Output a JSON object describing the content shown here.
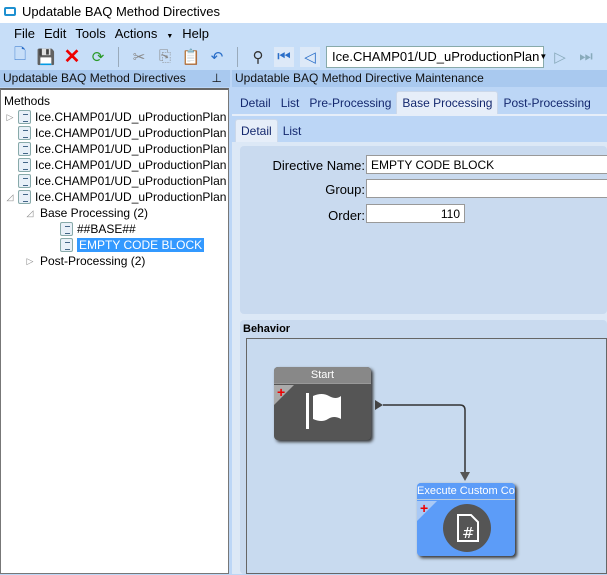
{
  "window": {
    "title": "Updatable BAQ Method Directives"
  },
  "menu": [
    "File",
    "Edit",
    "Tools",
    "Actions",
    "Help"
  ],
  "toolbar": {
    "navigator_value": "Ice.CHAMP01/UD_uProductionPlan"
  },
  "left_panel": {
    "header": "Updatable BAQ Method Directives",
    "root": "Methods",
    "methods": [
      "Ice.CHAMP01/UD_uProductionPlan",
      "Ice.CHAMP01/UD_uProductionPlan",
      "Ice.CHAMP01/UD_uProductionPlan",
      "Ice.CHAMP01/UD_uProductionPlan",
      "Ice.CHAMP01/UD_uProductionPlan",
      "Ice.CHAMP01/UD_uProductionPlan"
    ],
    "groups": {
      "base": "Base Processing (2)",
      "post": "Post-Processing (2)"
    },
    "directives": [
      "##BASE##",
      "EMPTY CODE BLOCK"
    ]
  },
  "right_panel": {
    "header": "Updatable BAQ Method Directive Maintenance",
    "tabs": [
      "Detail",
      "List",
      "Pre-Processing",
      "Base Processing",
      "Post-Processing"
    ],
    "subtabs": [
      "Detail",
      "List"
    ],
    "form": {
      "directive_name_label": "Directive Name:",
      "directive_name": "EMPTY CODE BLOCK",
      "group_label": "Group:",
      "group": "",
      "order_label": "Order:",
      "order": "110"
    },
    "behavior": {
      "label": "Behavior",
      "start_label": "Start",
      "custom_label": "Execute Custom Code"
    }
  }
}
